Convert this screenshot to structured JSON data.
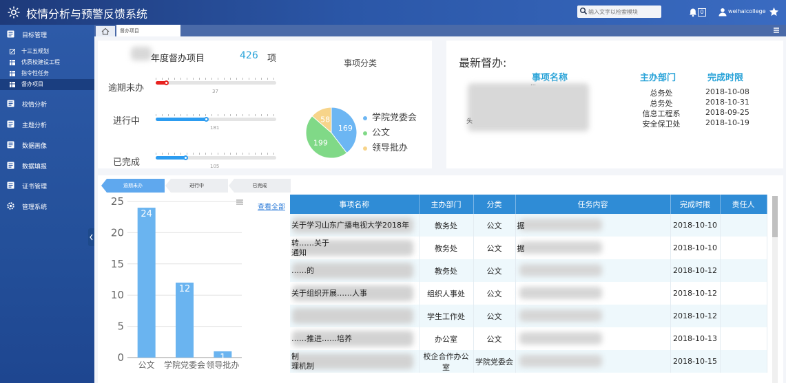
{
  "app": {
    "title": "校情分析与预警反馈系统"
  },
  "search": {
    "placeholder": "输入文字以检索模块"
  },
  "header": {
    "notification_count": "0",
    "username": "weihaicollege"
  },
  "sidebar": {
    "items": [
      {
        "label": "目标管理",
        "icon": "target-icon"
      },
      {
        "label": "校情分析",
        "icon": "chart-icon"
      },
      {
        "label": "主题分析",
        "icon": "topic-icon"
      },
      {
        "label": "数据画像",
        "icon": "portrait-icon"
      },
      {
        "label": "数据填报",
        "icon": "form-icon"
      },
      {
        "label": "证书管理",
        "icon": "certificate-icon"
      },
      {
        "label": "管理系统",
        "icon": "gear-icon"
      }
    ],
    "subitems": [
      {
        "label": "十三五规划"
      },
      {
        "label": "优质校建设工程"
      },
      {
        "label": "指令性任务"
      },
      {
        "label": "督办项目",
        "active": true
      }
    ]
  },
  "tabs": {
    "current": "督办项目"
  },
  "stats": {
    "title": "年度督办项目",
    "total": "426",
    "unit": "项",
    "overdue": {
      "label": "逾期未办",
      "value": "37",
      "fraction": 0.09
    },
    "inprogress": {
      "label": "进行中",
      "value": "181",
      "fraction": 0.42
    },
    "done": {
      "label": "已完成",
      "value": "105",
      "fraction": 0.25
    }
  },
  "category": {
    "title": "事项分类",
    "slices": [
      {
        "name": "学院党委会",
        "value": 169,
        "color": "#6cb6f3"
      },
      {
        "name": "公文",
        "value": 199,
        "color": "#80d987"
      },
      {
        "name": "领导批办",
        "value": 58,
        "color": "#f7d48a"
      }
    ]
  },
  "latest": {
    "title": "最新督办:",
    "headers": {
      "name": "事项名称",
      "dept": "主办部门",
      "due": "完成时限"
    },
    "rows": [
      {
        "dept": "总务处",
        "due": "2018-10-08"
      },
      {
        "dept": "总务处",
        "due": "2018-10-31"
      },
      {
        "dept": "信息工程系",
        "due": "2018-09-25"
      },
      {
        "dept": "安全保卫处",
        "due": "2018-10-19"
      }
    ],
    "fragments": {
      "frag1": "…",
      "frag2": "头"
    }
  },
  "bottom_tabs": [
    "逾期未办",
    "进行中",
    "已完成"
  ],
  "view_all": "查看全部",
  "chart_data": {
    "type": "bar",
    "categories": [
      "公文",
      "学院党委会",
      "领导批办"
    ],
    "values": [
      24,
      12,
      1
    ],
    "ylim": [
      0,
      25
    ],
    "yticks": [
      0,
      5,
      10,
      15,
      20,
      25
    ],
    "title": "",
    "xlabel": "",
    "ylabel": "",
    "color": "#6ab4f0",
    "grid": true
  },
  "table": {
    "headers": [
      "事项名称",
      "主办部门",
      "分类",
      "任务内容",
      "完成时限",
      "责任人"
    ],
    "rows": [
      {
        "name_top": "关于学习山东广播电视大学2018年",
        "name_bottom": "",
        "dept": "教务处",
        "category": "公文",
        "content": "据",
        "due": "2018-10-10",
        "owner": ""
      },
      {
        "name_top": "转……关于",
        "name_bottom": "通知",
        "dept": "教务处",
        "category": "公文",
        "content": "据",
        "due": "2018-10-10",
        "owner": ""
      },
      {
        "name_top": "……的",
        "name_bottom": "",
        "dept": "教务处",
        "category": "公文",
        "content": "",
        "due": "2018-10-12",
        "owner": ""
      },
      {
        "name_top": "关于组织开展……人事",
        "name_bottom": "",
        "dept": "组织人事处",
        "category": "公文",
        "content": "",
        "due": "2018-10-12",
        "owner": ""
      },
      {
        "name_top": "",
        "name_bottom": "",
        "dept": "学生工作处",
        "category": "公文",
        "content": "",
        "due": "2018-10-12",
        "owner": ""
      },
      {
        "name_top": "……推进……培养",
        "name_bottom": "",
        "dept": "办公室",
        "category": "公文",
        "content": "",
        "due": "2018-10-13",
        "owner": ""
      },
      {
        "name_top": "制",
        "name_bottom": "理机制",
        "dept": "校企合作办公室",
        "category": "学院党委会",
        "content": "",
        "due": "2018-10-15",
        "owner": ""
      }
    ]
  }
}
